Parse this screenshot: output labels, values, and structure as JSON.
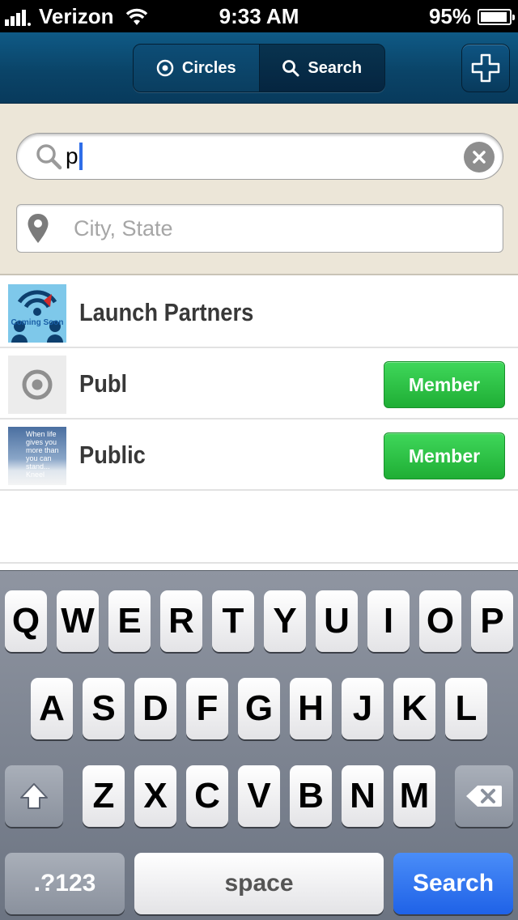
{
  "status_bar": {
    "carrier": "Verizon",
    "time": "9:33 AM",
    "battery": "95%",
    "battery_level": 0.95
  },
  "nav": {
    "segments": [
      {
        "label": "Circles",
        "icon": "target-icon"
      },
      {
        "label": "Search",
        "icon": "search-icon"
      }
    ],
    "add_icon": "plus-icon"
  },
  "search": {
    "query": "p",
    "location_placeholder": "City, State"
  },
  "results": [
    {
      "name": "Launch Partners",
      "thumb": "coming-soon-image",
      "thumb_text": "Coming Soon",
      "member": ""
    },
    {
      "name": "Publ",
      "thumb": "target-placeholder-icon",
      "thumb_text": "",
      "member": "Member"
    },
    {
      "name": "Public",
      "thumb": "quote-photo-image",
      "thumb_text": "When life gives you more than you can stand... Kneel",
      "member": "Member"
    }
  ],
  "keyboard": {
    "row1": [
      "Q",
      "W",
      "E",
      "R",
      "T",
      "Y",
      "U",
      "I",
      "O",
      "P"
    ],
    "row2": [
      "A",
      "S",
      "D",
      "F",
      "G",
      "H",
      "J",
      "K",
      "L"
    ],
    "row3": [
      "Z",
      "X",
      "C",
      "V",
      "B",
      "N",
      "M"
    ],
    "shift_icon": "shift-icon",
    "delete_icon": "delete-icon",
    "numbers_label": ".?123",
    "space_label": "space",
    "go_label": "Search"
  },
  "colors": {
    "nav_blue": "#0a4468",
    "member_green": "#2bc244",
    "keyboard_blue": "#1f62e7",
    "panel_beige": "#ece6d8"
  }
}
